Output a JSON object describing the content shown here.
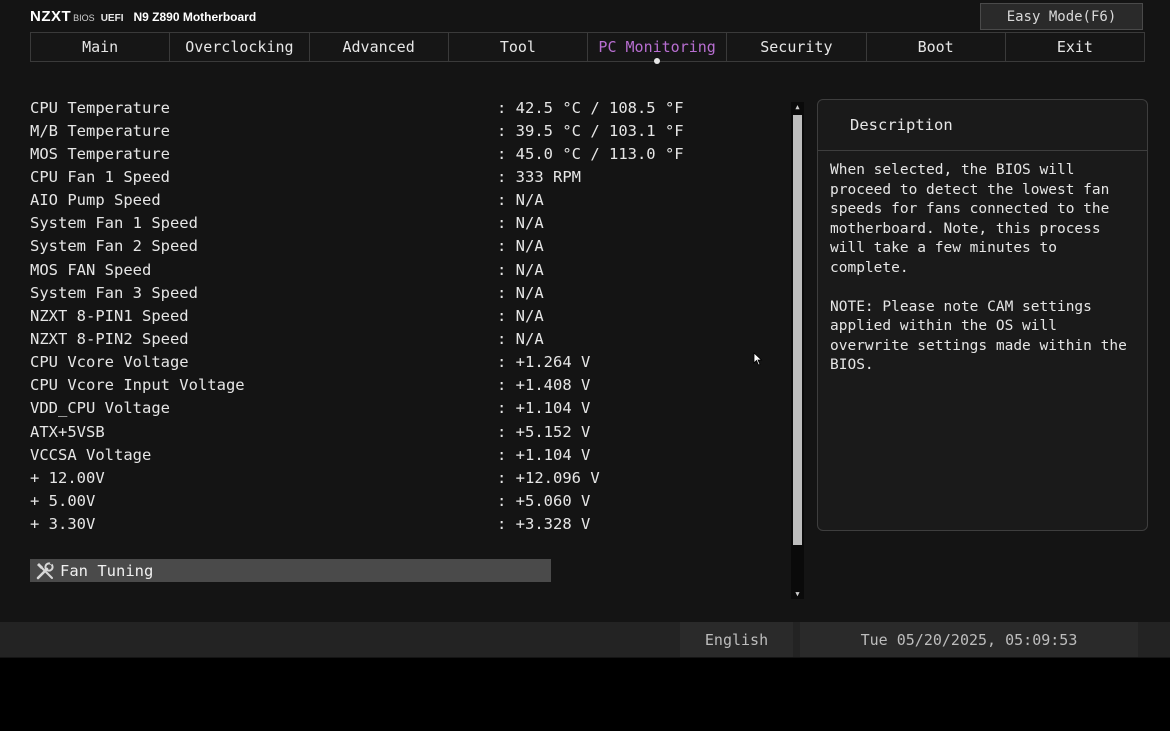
{
  "header": {
    "brand_logo": "NZXT",
    "brand_bios": "BIOS",
    "brand_uefi": "UEFI",
    "model": "N9 Z890 Motherboard",
    "easy_mode_label": "Easy Mode(F6)"
  },
  "tabs": [
    {
      "label": "Main",
      "active": false
    },
    {
      "label": "Overclocking",
      "active": false
    },
    {
      "label": "Advanced",
      "active": false
    },
    {
      "label": "Tool",
      "active": false
    },
    {
      "label": "PC Monitoring",
      "active": true
    },
    {
      "label": "Security",
      "active": false
    },
    {
      "label": "Boot",
      "active": false
    },
    {
      "label": "Exit",
      "active": false
    }
  ],
  "monitoring": {
    "rows": [
      {
        "label": "CPU Temperature",
        "value": ": 42.5 °C / 108.5 °F"
      },
      {
        "label": "M/B Temperature",
        "value": ": 39.5 °C / 103.1 °F"
      },
      {
        "label": "MOS Temperature",
        "value": ": 45.0 °C / 113.0 °F"
      },
      {
        "label": "CPU Fan 1 Speed",
        "value": ": 333 RPM"
      },
      {
        "label": "AIO Pump Speed",
        "value": ": N/A"
      },
      {
        "label": "System Fan 1 Speed",
        "value": ": N/A"
      },
      {
        "label": "System Fan 2 Speed",
        "value": ": N/A"
      },
      {
        "label": "MOS FAN Speed",
        "value": ": N/A"
      },
      {
        "label": "System Fan 3 Speed",
        "value": ": N/A"
      },
      {
        "label": "NZXT 8-PIN1 Speed",
        "value": ": N/A"
      },
      {
        "label": "NZXT 8-PIN2 Speed",
        "value": ": N/A"
      },
      {
        "label": "CPU Vcore Voltage",
        "value": ": +1.264 V"
      },
      {
        "label": "CPU Vcore Input Voltage",
        "value": ": +1.408 V"
      },
      {
        "label": "VDD_CPU Voltage",
        "value": ": +1.104 V"
      },
      {
        "label": "ATX+5VSB",
        "value": ": +5.152 V"
      },
      {
        "label": "VCCSA Voltage",
        "value": ": +1.104 V"
      },
      {
        "label": "+ 12.00V",
        "value": ": +12.096 V"
      },
      {
        "label": "+ 5.00V",
        "value": ": +5.060 V"
      },
      {
        "label": "+ 3.30V",
        "value": ": +3.328 V"
      }
    ],
    "fan_tuning_label": "Fan Tuning",
    "fan_tuning_icon": "wrench-screwdriver-icon"
  },
  "description": {
    "title": "Description",
    "paragraphs": [
      "When selected, the BIOS will proceed to detect the lowest fan speeds for fans connected to the motherboard. Note, this process will take a few minutes to complete.",
      "NOTE: Please note CAM settings applied within the OS will overwrite settings made within the BIOS."
    ]
  },
  "footer": {
    "language": "English",
    "datetime": "Tue 05/20/2025, 05:09:53"
  },
  "colors": {
    "active_tab": "#b86ed1",
    "background": "#141414",
    "highlight_row": "#4a4a4a"
  }
}
